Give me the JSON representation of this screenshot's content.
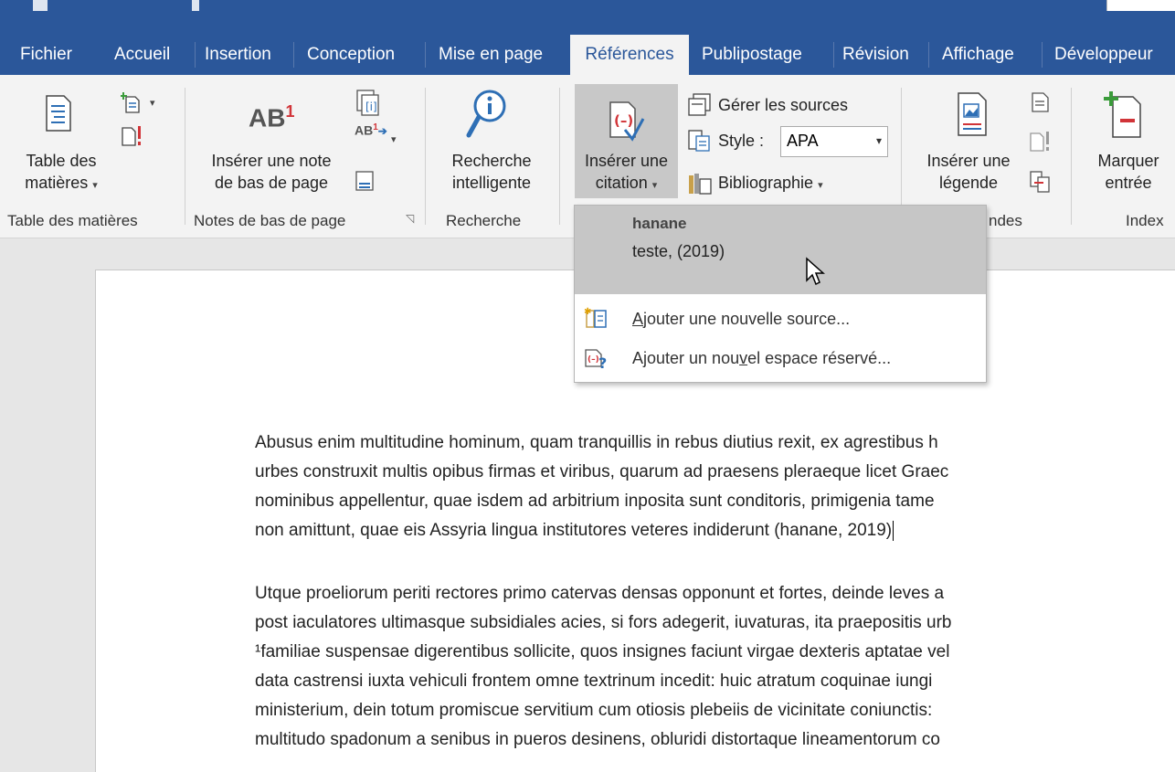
{
  "tabs": [
    {
      "label": "Fichier"
    },
    {
      "label": "Accueil"
    },
    {
      "label": "Insertion"
    },
    {
      "label": "Conception"
    },
    {
      "label": "Mise en page"
    },
    {
      "label": "Références"
    },
    {
      "label": "Publipostage"
    },
    {
      "label": "Révision"
    },
    {
      "label": "Affichage"
    },
    {
      "label": "Développeur"
    }
  ],
  "ribbon": {
    "toc": {
      "line1": "Table des",
      "line2": "matières",
      "group": "Table des matières"
    },
    "footnotes": {
      "big_icon_text": "AB",
      "big_icon_sup": "1",
      "line1": "Insérer une note",
      "line2": "de bas de page",
      "small_icon_text": "AB",
      "small_icon_sup": "1",
      "group": "Notes de bas de page"
    },
    "research": {
      "line1": "Recherche",
      "line2": "intelligente",
      "group": "Recherche"
    },
    "citations": {
      "insert_line1": "Insérer une",
      "insert_line2": "citation",
      "manage_sources": "Gérer les sources",
      "style_label": "Style :",
      "style_value": "APA",
      "bibliography": "Bibliographie"
    },
    "captions": {
      "line1": "Insérer une",
      "line2": "légende",
      "group": "ndes"
    },
    "index": {
      "line1": "Marquer",
      "line2": "entrée",
      "group": "Index"
    }
  },
  "citation_menu": {
    "author": "hanane",
    "reference": "teste, (2019)",
    "add_source": "Ajouter une nouvelle source...",
    "add_source_mnemonic": "A",
    "add_placeholder_pre": "Ajouter un nou",
    "add_placeholder_mnemonic": "v",
    "add_placeholder_post": "el espace réservé..."
  },
  "document": {
    "p1": [
      "Abusus enim multitudine hominum, quam tranquillis in rebus diutius rexit, ex agrestibus h",
      "urbes construxit multis opibus firmas et viribus, quarum ad praesens pleraeque licet Graec",
      "nominibus appellentur, quae isdem ad arbitrium inposita sunt conditoris, primigenia tame",
      "non amittunt, quae eis Assyria lingua institutores veteres indiderunt (hanane, 2019)"
    ],
    "p2": [
      "Utque proeliorum periti rectores primo catervas densas opponunt et fortes, deinde leves a",
      "post iaculatores ultimasque subsidiales acies, si fors adegerit, iuvaturas, ita praepositis urb",
      "¹familiae suspensae digerentibus sollicite, quos insignes faciunt virgae dexteris aptatae vel",
      "data castrensi iuxta vehiculi frontem omne textrinum incedit: huic atratum coquinae iungi",
      "ministerium, dein totum promiscue servitium cum otiosis plebeiis de vicinitate coniunctis:",
      "multitudo spadonum a senibus in pueros desinens, obluridi distortaque lineamentorum co"
    ]
  },
  "colors": {
    "brand": "#2b579a",
    "ribbon": "#f3f3f3",
    "accent_red": "#d13438",
    "icon_blue": "#2e6fb5"
  }
}
